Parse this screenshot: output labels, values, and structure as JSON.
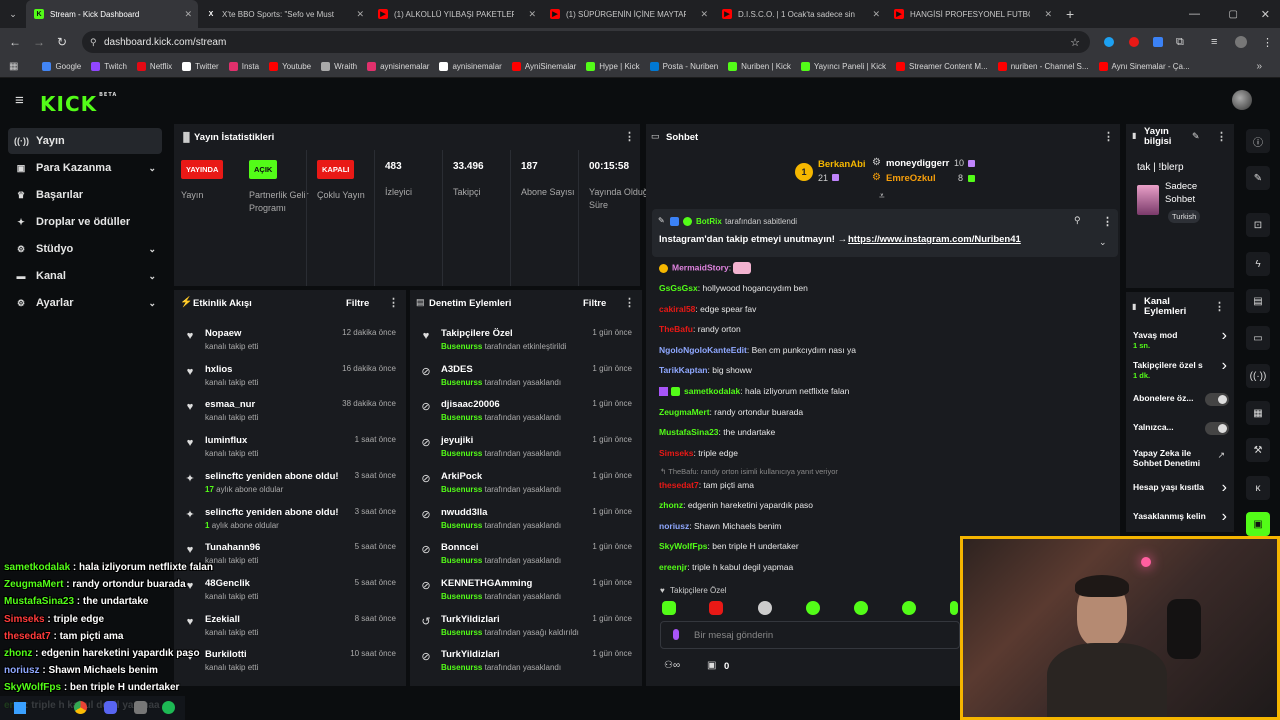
{
  "browser": {
    "tabs": [
      {
        "title": "Stream - Kick Dashboard",
        "icon": "kick-icon",
        "color": "#53fc18"
      },
      {
        "title": "X'te BBO Sports: \"Sefo ve Must",
        "icon": "x-icon",
        "color": "#ffffff"
      },
      {
        "title": "(1) ALKOLLÜ YILBAŞI PAKETLERİ",
        "icon": "youtube-icon",
        "color": "#ff0000"
      },
      {
        "title": "(1) SÜPÜRGENİN İÇİNE MAYTAP",
        "icon": "youtube-icon",
        "color": "#ff0000"
      },
      {
        "title": "D.I.S.C.O. | 1 Ocak'ta sadece sin",
        "icon": "youtube-icon",
        "color": "#ff0000"
      },
      {
        "title": "HANGİSİ PROFESYONEL FUTBO",
        "icon": "youtube-icon",
        "color": "#ff0000"
      }
    ],
    "url": "dashboard.kick.com/stream",
    "bookmarks": [
      {
        "label": "Google",
        "color": "#4285f4"
      },
      {
        "label": "Twitch",
        "color": "#9146ff"
      },
      {
        "label": "Netflix",
        "color": "#e50914"
      },
      {
        "label": "Twitter",
        "color": "#ffffff"
      },
      {
        "label": "Insta",
        "color": "#e1306c"
      },
      {
        "label": "Youtube",
        "color": "#ff0000"
      },
      {
        "label": "Wraith",
        "color": "#aaaaaa"
      },
      {
        "label": "aynisinemalar",
        "color": "#e1306c"
      },
      {
        "label": "aynisinemalar",
        "color": "#ffffff"
      },
      {
        "label": "AyniSinemalar",
        "color": "#ff0000"
      },
      {
        "label": "Hype | Kick",
        "color": "#53fc18"
      },
      {
        "label": "Posta - Nuriben",
        "color": "#0078d4"
      },
      {
        "label": "Nuriben | Kick",
        "color": "#53fc18"
      },
      {
        "label": "Yayıncı Paneli | Kick",
        "color": "#53fc18"
      },
      {
        "label": "Streamer Content M...",
        "color": "#ff0000"
      },
      {
        "label": "nuriben - Channel S...",
        "color": "#ff0000"
      },
      {
        "label": "Aynı Sinemalar - Ça...",
        "color": "#ff0000"
      }
    ]
  },
  "kick": {
    "logo": "KICK",
    "logo_sup": "BETA",
    "nav": [
      {
        "label": "Yayın",
        "icon": "broadcast-icon",
        "glyph": "((·))"
      },
      {
        "label": "Para Kazanma",
        "icon": "money-icon",
        "glyph": "▣",
        "chevron": true
      },
      {
        "label": "Başarılar",
        "icon": "trophy-icon",
        "glyph": "♛"
      },
      {
        "label": "Droplar ve ödüller",
        "icon": "gift-icon",
        "glyph": "✦"
      },
      {
        "label": "Stüdyo",
        "icon": "studio-icon",
        "glyph": "⚙",
        "chevron": true
      },
      {
        "label": "Kanal",
        "icon": "channel-icon",
        "glyph": "▬",
        "chevron": true
      },
      {
        "label": "Ayarlar",
        "icon": "settings-icon",
        "glyph": "⚙",
        "chevron": true
      }
    ],
    "stats": {
      "title": "Yayın İstatistikleri",
      "items": [
        {
          "badge": "YAYINDA",
          "badge_color": "#e91916",
          "label": "Yayın"
        },
        {
          "badge": "AÇIK",
          "badge_color": "#53fc18",
          "label": "Partnerlik Gelir Programı"
        },
        {
          "badge": "KAPALI",
          "badge_color": "#e91916",
          "label": "Çoklu Yayın"
        },
        {
          "value": "483",
          "label": "İzleyici"
        },
        {
          "value": "33.496",
          "label": "Takipçi"
        },
        {
          "value": "187",
          "label": "Abone Sayısı"
        },
        {
          "value": "00:15:58",
          "label": "Yayında Olduğu Süre"
        }
      ]
    },
    "activity": {
      "title": "Etkinlik Akışı",
      "filter": "Filtre",
      "rows": [
        {
          "name": "Nopaew",
          "sub": "kanalı takip etti",
          "time": "12 dakika önce",
          "type": "heart"
        },
        {
          "name": "hxlios",
          "sub": "kanalı takip etti",
          "time": "16 dakika önce",
          "type": "heart"
        },
        {
          "name": "esmaa_nur",
          "sub": "kanalı takip etti",
          "time": "38 dakika önce",
          "type": "heart"
        },
        {
          "name": "luminflux",
          "sub": "kanalı takip etti",
          "time": "1 saat önce",
          "type": "heart"
        },
        {
          "name": "selincftc yeniden abone oldu!",
          "sub_hl": "17",
          "sub": "aylık abone oldular",
          "time": "3 saat önce",
          "type": "star"
        },
        {
          "name": "selincftc yeniden abone oldu!",
          "sub_hl": "1",
          "sub": "aylık abone oldular",
          "time": "3 saat önce",
          "type": "star"
        },
        {
          "name": "Tunahann96",
          "sub": "kanalı takip etti",
          "time": "5 saat önce",
          "type": "heart"
        },
        {
          "name": "48Genclik",
          "sub": "kanalı takip etti",
          "time": "5 saat önce",
          "type": "heart"
        },
        {
          "name": "Ezekiall",
          "sub": "kanalı takip etti",
          "time": "8 saat önce",
          "type": "heart"
        },
        {
          "name": "Burkilotti",
          "sub": "kanalı takip etti",
          "time": "10 saat önce",
          "type": "heart"
        }
      ]
    },
    "moderation": {
      "title": "Denetim Eylemleri",
      "filter": "Filtre",
      "rows": [
        {
          "name": "Takipçilere Özel",
          "mod": "Busenurss",
          "sub": "tarafından etkinleştirildi",
          "time": "1 gün önce",
          "type": "heart"
        },
        {
          "name": "A3DES",
          "mod": "Busenurss",
          "sub": "tarafından yasaklandı",
          "time": "1 gün önce",
          "type": "ban"
        },
        {
          "name": "djisaac20006",
          "mod": "Busenurss",
          "sub": "tarafından yasaklandı",
          "time": "1 gün önce",
          "type": "ban"
        },
        {
          "name": "jeyujiki",
          "mod": "Busenurss",
          "sub": "tarafından yasaklandı",
          "time": "1 gün önce",
          "type": "ban"
        },
        {
          "name": "ArkiPock",
          "mod": "Busenurss",
          "sub": "tarafından yasaklandı",
          "time": "1 gün önce",
          "type": "ban"
        },
        {
          "name": "nwudd3lla",
          "mod": "Busenurss",
          "sub": "tarafından yasaklandı",
          "time": "1 gün önce",
          "type": "ban"
        },
        {
          "name": "Bonncei",
          "mod": "Busenurss",
          "sub": "tarafından yasaklandı",
          "time": "1 gün önce",
          "type": "ban"
        },
        {
          "name": "KENNETHGAmming",
          "mod": "Busenurss",
          "sub": "tarafından yasaklandı",
          "time": "1 gün önce",
          "type": "ban"
        },
        {
          "name": "TurkYildizlari",
          "mod": "Busenurss",
          "sub": "tarafından yasağı kaldırıldı",
          "time": "1 gün önce",
          "type": "undo"
        },
        {
          "name": "TurkYildizlari",
          "mod": "Busenurss",
          "sub": "tarafından yasaklandı",
          "time": "1 gün önce",
          "type": "ban"
        }
      ]
    },
    "chat": {
      "title": "Sohbet",
      "leaders": [
        {
          "rank": "1",
          "name": "BerkanAbi",
          "count": "21"
        },
        {
          "name": "moneydiggerr",
          "count": "10"
        },
        {
          "name": "EmreOzkul",
          "count": "8"
        }
      ],
      "pinned_by": "BotRix",
      "pinned_suffix": "tarafından sabitlendi",
      "pinned_text": "Instagram'dan takip etmeyi unutmayın! →",
      "pinned_link": "https://www.instagram.com/Nuriben41",
      "messages": [
        {
          "user": "MermaidStory",
          "color": "#e084e0",
          "text": ""
        },
        {
          "user": "GsGsGsx",
          "color": "#53fc18",
          "text": "hollywood hogancıydım ben"
        },
        {
          "user": "cakiral58",
          "color": "#e91916",
          "text": "edge spear fav"
        },
        {
          "user": "TheBafu",
          "color": "#e91916",
          "text": "randy orton"
        },
        {
          "user": "NgoloNgoloKanteEdit",
          "color": "#8fa8ff",
          "text": "Ben cm punkcıydım nası ya"
        },
        {
          "user": "TarikKaptan",
          "color": "#8fa8ff",
          "text": "big showw"
        },
        {
          "user": "sametkodalak",
          "color": "#53fc18",
          "text": "hala izliyorum netflixte falan"
        },
        {
          "user": "ZeugmaMert",
          "color": "#53fc18",
          "text": "randy ortondur buarada"
        },
        {
          "user": "MustafaSina23",
          "color": "#53fc18",
          "text": "the undartake"
        },
        {
          "user": "Simseks",
          "color": "#e91916",
          "text": "triple edge"
        },
        {
          "user": "thesedat7",
          "color": "#e91916",
          "text": "tam piçti ama"
        },
        {
          "user": "zhonz",
          "color": "#53fc18",
          "text": "edgenin hareketini yapardık paso"
        },
        {
          "user": "noriusz",
          "color": "#8fa8ff",
          "text": "Shawn Michaels benim"
        },
        {
          "user": "SkyWolfFps",
          "color": "#53fc18",
          "text": "ben triple H undertaker"
        },
        {
          "user": "ereenjr",
          "color": "#53fc18",
          "text": "triple h kabul degil yapmaa"
        }
      ],
      "reply_note": "TheBafu: randy orton isimli kullanıcıya yanıt veriyor",
      "mode": "Takipçilere Özel",
      "placeholder": "Bir mesaj gönderin",
      "points": "0"
    },
    "stream_info": {
      "title": "Yayın bilgisi",
      "stream_title": "tak | !blerp",
      "category": "Sadece Sohbet",
      "tag": "Turkish"
    },
    "channel_actions": {
      "title": "Kanal Eylemleri",
      "items": [
        {
          "label": "Yavaş mod",
          "sub": "1 sn.",
          "ctl": "chevron"
        },
        {
          "label": "Takipçilere özel s",
          "sub": "1 dk.",
          "ctl": "chevron"
        },
        {
          "label": "Abonelere öz...",
          "ctl": "toggle"
        },
        {
          "label": "Yalnızca...",
          "ctl": "toggle"
        },
        {
          "label": "Yapay Zeka ile Sohbet Denetimi",
          "ctl": "external"
        },
        {
          "label": "Hesap yaşı kısıtla",
          "ctl": "chevron"
        },
        {
          "label": "Yasaklanmış kelin",
          "ctl": "chevron"
        }
      ]
    },
    "overlay_chat": [
      {
        "user": "sametkodalak",
        "color": "#53fc18",
        "text": " : hala izliyorum netflixte falan"
      },
      {
        "user": "ZeugmaMert",
        "color": "#53fc18",
        "text": " : randy ortondur buarada"
      },
      {
        "user": "MustafaSina23",
        "color": "#53fc18",
        "text": " : the undartake"
      },
      {
        "user": "Simseks",
        "color": "#ff3b3b",
        "text": " : triple edge"
      },
      {
        "user": "thesedat7",
        "color": "#ff3b3b",
        "text": " : tam piçti ama"
      },
      {
        "user": "zhonz",
        "color": "#53fc18",
        "text": " : edgenin hareketini yapardık paso"
      },
      {
        "user": "noriusz",
        "color": "#8fa8ff",
        "text": " : Shawn Michaels benim"
      },
      {
        "user": "SkyWolfFps",
        "color": "#53fc18",
        "text": " : ben triple H undertaker"
      },
      {
        "user": "enjr",
        "color": "#53fc18",
        "text": " : triple h kabul degil yapmaa"
      }
    ]
  }
}
